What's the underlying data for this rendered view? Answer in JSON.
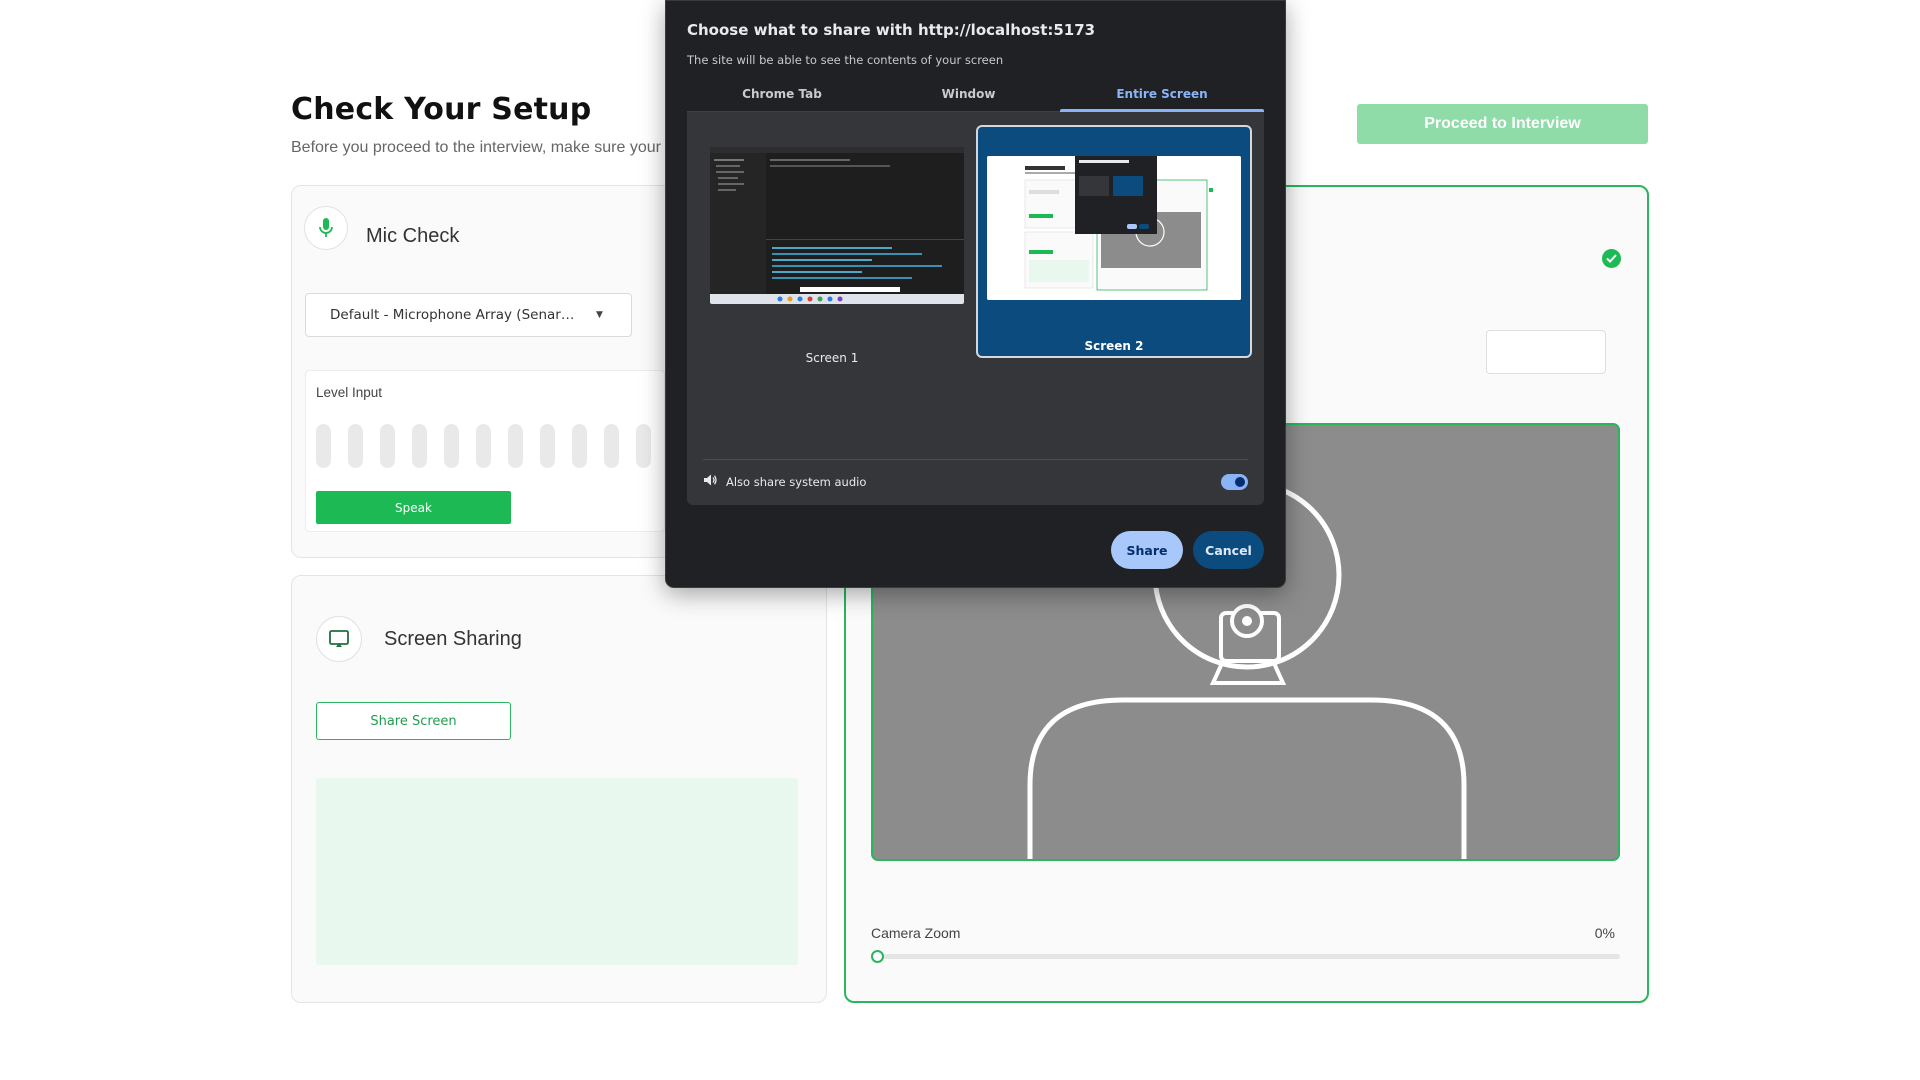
{
  "page": {
    "title": "Check Your Setup",
    "subtitle": "Before you proceed to the interview, make sure your",
    "proceed_label": "Proceed to Interview",
    "proceed_color": "#8fdca9"
  },
  "mic": {
    "heading": "Mic Check",
    "device": "Default - Microphone Array (Senary ...",
    "level_label": "Level Input",
    "level_bars": 11,
    "speak_label": "Speak"
  },
  "screen_sharing": {
    "heading": "Screen Sharing",
    "share_label": "Share Screen"
  },
  "camera": {
    "zoom_label": "Camera Zoom",
    "zoom_value": "0%",
    "zoom_fraction": 0
  },
  "dialog": {
    "title": "Choose what to share with http://localhost:5173",
    "subtitle": "The site will be able to see the contents of your screen",
    "tabs": [
      "Chrome Tab",
      "Window",
      "Entire Screen"
    ],
    "active_tab": "Entire Screen",
    "screens": [
      "Screen 1",
      "Screen 2"
    ],
    "selected_screen": "Screen 2",
    "audio_label": "Also share system audio",
    "audio_enabled": true,
    "share_label": "Share",
    "cancel_label": "Cancel"
  },
  "colors": {
    "accent_green": "#1db954",
    "dialog_bg": "#202124",
    "dialog_accent": "#8ab4f8",
    "selected_tile": "#0b4b7d"
  }
}
